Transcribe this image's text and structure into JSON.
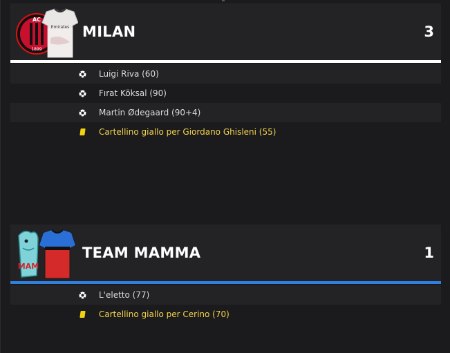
{
  "teams": [
    {
      "name": "MILAN",
      "score": "3",
      "accent": "#ffffff",
      "logo": "ac-milan-crest",
      "kit": "white-away-shirt",
      "events": [
        {
          "type": "goal",
          "icon": "ball-icon",
          "text": "Luigi Riva (60)"
        },
        {
          "type": "goal",
          "icon": "ball-icon",
          "text": "Fırat Köksal (90)"
        },
        {
          "type": "goal",
          "icon": "ball-icon",
          "text": "Martin Ødegaard (90+4)"
        },
        {
          "type": "yellow",
          "icon": "yellow-card-icon",
          "text": "Cartellino giallo per Giordano Ghisleni (55)"
        }
      ]
    },
    {
      "name": "TEAM MAMMA",
      "score": "1",
      "accent": "#2f7fe0",
      "logo": "team-mamma-crest",
      "kit": "blue-red-shirt",
      "events": [
        {
          "type": "goal",
          "icon": "ball-icon",
          "text": "L'eletto (77)"
        },
        {
          "type": "yellow",
          "icon": "yellow-card-icon",
          "text": "Cartellino giallo per Cerino (70)"
        }
      ]
    }
  ],
  "colors": {
    "background": "#1b1b1d",
    "row_alt": "#232326",
    "yellow_text": "#f3d34a",
    "yellow_card": "#f3d10e"
  }
}
